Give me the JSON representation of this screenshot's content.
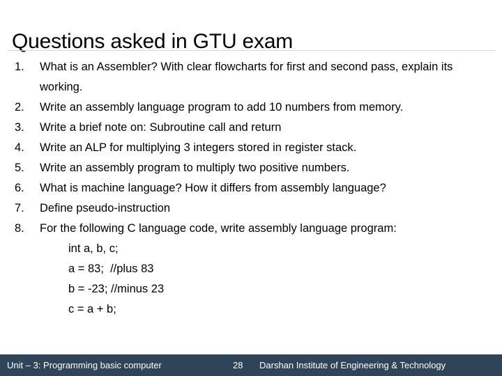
{
  "slide": {
    "title": "Questions asked in GTU exam",
    "background_color": "#ffffff",
    "text_color": "#000000",
    "rule_color": "#d6d6d6"
  },
  "questions": [
    {
      "number": "1.",
      "text": "What is an Assembler? With clear flowcharts for first and second pass, explain its working."
    },
    {
      "number": "2.",
      "text": "Write an assembly language program to add 10 numbers from memory."
    },
    {
      "number": "3.",
      "text": "Write a brief note on: Subroutine call and return"
    },
    {
      "number": "4.",
      "text": "Write an ALP for multiplying 3 integers stored in register stack."
    },
    {
      "number": "5.",
      "text": "Write an assembly program to multiply two positive numbers."
    },
    {
      "number": "6.",
      "text": "What is machine language? How it differs from assembly language?"
    },
    {
      "number": "7.",
      "text": "Define pseudo-instruction"
    },
    {
      "number": "8.",
      "text": "For the following C language code, write assembly language program:"
    }
  ],
  "code_block": {
    "lines": [
      "int a, b, c;",
      "a = 83;  //plus 83",
      "b = -23; //minus 23",
      "c = a + b;"
    ]
  },
  "footer": {
    "unit": "Unit – 3: Programming basic computer",
    "page_number": "28",
    "institute": "Darshan Institute of Engineering & Technology",
    "background_color": "#2f4459",
    "text_color": "#ffffff"
  }
}
